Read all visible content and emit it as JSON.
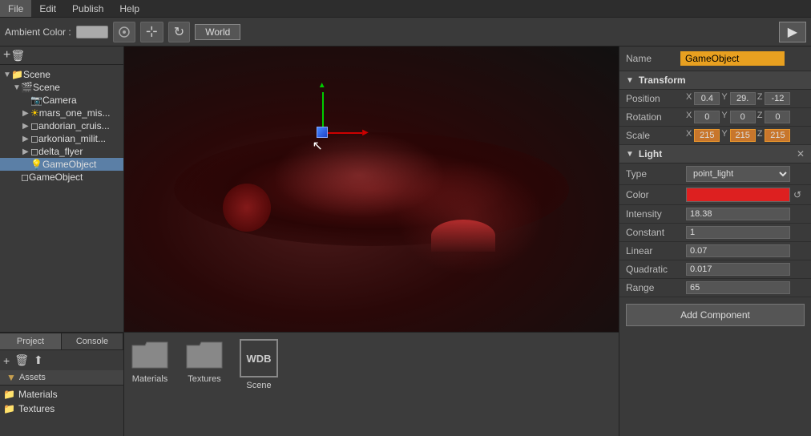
{
  "menu": {
    "items": [
      "File",
      "Edit",
      "Publish",
      "Help"
    ]
  },
  "toolbar": {
    "ambient_color_label": "Ambient Color :",
    "world_button": "World",
    "move_icon": "⊹",
    "rotate_icon": "↻",
    "play_icon": "▶"
  },
  "scene_tree": {
    "items": [
      {
        "label": "Scene",
        "indent": 0,
        "arrow": "▼",
        "selected": false
      },
      {
        "label": "Scene",
        "indent": 1,
        "arrow": "▼",
        "selected": false
      },
      {
        "label": "Camera",
        "indent": 2,
        "arrow": "",
        "selected": false
      },
      {
        "label": "mars_one_mis...",
        "indent": 2,
        "arrow": "▶",
        "selected": false,
        "has_sun": true
      },
      {
        "label": "andorian_cruis...",
        "indent": 2,
        "arrow": "▶",
        "selected": false
      },
      {
        "label": "arkonian_milit...",
        "indent": 2,
        "arrow": "▶",
        "selected": false
      },
      {
        "label": "delta_flyer",
        "indent": 2,
        "arrow": "▶",
        "selected": false
      },
      {
        "label": "GameObject",
        "indent": 2,
        "arrow": "",
        "selected": true
      },
      {
        "label": "GameObject",
        "indent": 1,
        "arrow": "",
        "selected": false
      }
    ]
  },
  "tabs": {
    "left": [
      "Project",
      "Console"
    ]
  },
  "assets": {
    "header": "Assets",
    "items": [
      {
        "label": "Materials",
        "type": "folder"
      },
      {
        "label": "Textures",
        "type": "folder"
      }
    ],
    "content_items": [
      {
        "label": "Materials",
        "type": "folder"
      },
      {
        "label": "Textures",
        "type": "folder"
      },
      {
        "label": "Scene",
        "type": "wdb"
      }
    ]
  },
  "properties": {
    "name_label": "Name",
    "name_value": "GameObject",
    "transform": {
      "title": "Transform",
      "position": {
        "label": "Position",
        "x": "0.4",
        "y": "29.",
        "z": "-12"
      },
      "rotation": {
        "label": "Rotation",
        "x": "0",
        "y": "0",
        "z": "0"
      },
      "scale": {
        "label": "Scale",
        "x": "215",
        "y": "215",
        "z": "215"
      }
    },
    "light": {
      "title": "Light",
      "type_label": "Type",
      "type_value": "point_light",
      "color_label": "Color",
      "intensity_label": "Intensity",
      "intensity_value": "18.38",
      "constant_label": "Constant",
      "constant_value": "1",
      "linear_label": "Linear",
      "linear_value": "0.07",
      "quadratic_label": "Quadratic",
      "quadratic_value": "0.017",
      "range_label": "Range",
      "range_value": "65"
    },
    "add_component": "Add Component"
  }
}
